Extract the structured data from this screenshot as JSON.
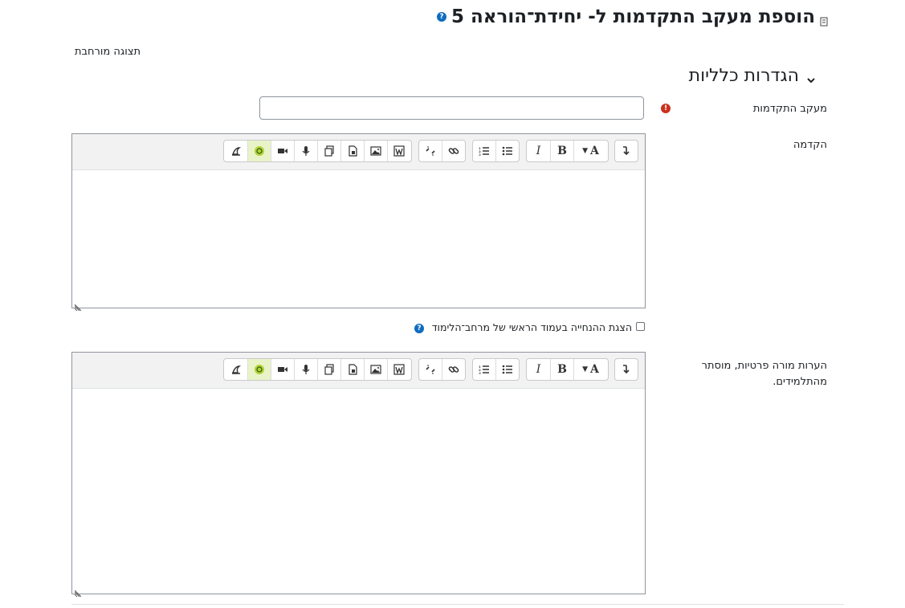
{
  "header": {
    "title": "הוספת מעקב התקדמות ל- יחידת־הוראה 5",
    "help_glyph": "?"
  },
  "expand_all": "תצוגה מורחבת",
  "section": {
    "title": "הגדרות כלליות"
  },
  "fields": {
    "name_label": "מעקב התקדמות",
    "name_value": "",
    "required_glyph": "!",
    "intro_label": "הקדמה",
    "show_description_label": "הצגת ההנחייה בעמוד הראשי של מרחב־הלימוד",
    "teacher_notes_label": "הערות מורה פרטיות, מוסתר מהתלמידים."
  },
  "toolbar": {
    "font_color_glyph": "A",
    "bold_glyph": "B",
    "italic_glyph": "I"
  },
  "colors": {
    "accent": "#0f6cbf",
    "required": "#ca3120",
    "toolbar_bg": "#f2f2f2",
    "border": "#8f959e",
    "green_button": "#b2d235"
  }
}
